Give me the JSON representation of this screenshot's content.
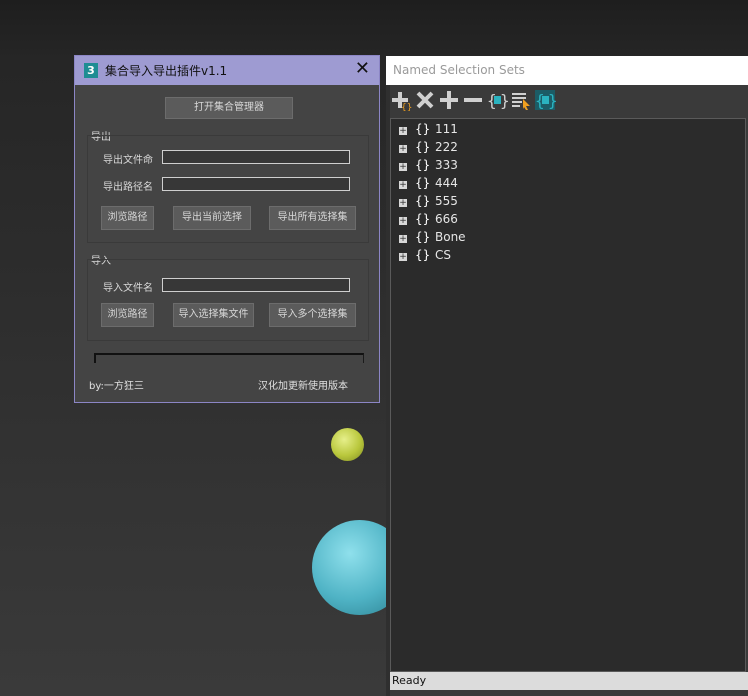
{
  "dialog": {
    "title": "集合导入导出插件v1.1",
    "app_icon": "3",
    "close_glyph": "✕",
    "open_manager_button": "打开集合管理器",
    "export_group": {
      "label": "导出",
      "file_name_label": "导出文件命",
      "file_name_value": "",
      "path_label": "导出路径名",
      "path_value": "",
      "browse_button": "浏览路径",
      "export_current_button": "导出当前选择",
      "export_all_button": "导出所有选择集"
    },
    "import_group": {
      "label": "导入",
      "file_name_label": "导入文件名",
      "file_name_value": "",
      "browse_button": "浏览路径",
      "import_file_button": "导入选择集文件",
      "import_multiple_button": "导入多个选择集"
    },
    "progress": 0,
    "author": "by:一方狂三",
    "note": "汉化加更新使用版本"
  },
  "nss": {
    "title": "Named Selection Sets",
    "toolbar_icons": [
      "create-set-icon",
      "delete-icon",
      "add-objects-icon",
      "remove-objects-icon",
      "select-objects-in-set-icon",
      "select-objects-by-name-icon",
      "highlight-selected-icon"
    ],
    "sets": [
      {
        "name": "111"
      },
      {
        "name": "222"
      },
      {
        "name": "333"
      },
      {
        "name": "444"
      },
      {
        "name": "555"
      },
      {
        "name": "666"
      },
      {
        "name": "Bone"
      },
      {
        "name": "CS"
      }
    ],
    "status": "Ready"
  },
  "colors": {
    "dialog_title_bg": "#9e9bd2",
    "viewport_sphere_small": "#c2d24a",
    "viewport_sphere_large": "#4fb3c5",
    "accent_icon": "#2bb3c0"
  }
}
